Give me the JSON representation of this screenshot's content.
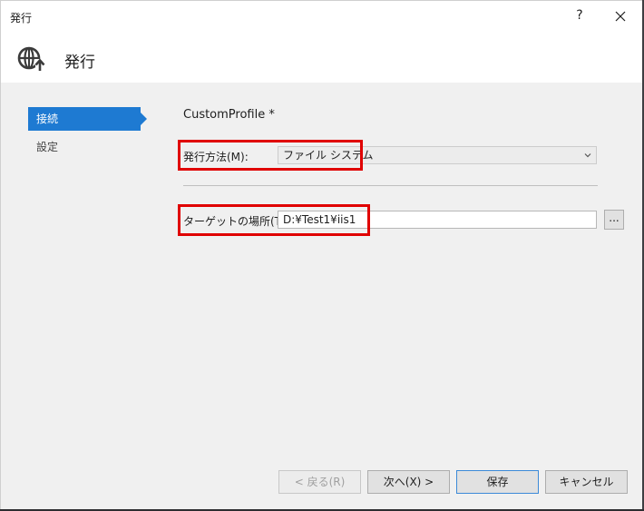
{
  "window": {
    "title": "発行",
    "help_label": "?"
  },
  "header": {
    "title": "発行"
  },
  "nav": {
    "items": [
      {
        "label": "接続",
        "active": true
      },
      {
        "label": "設定",
        "active": false
      }
    ]
  },
  "main": {
    "profile_name": "CustomProfile *",
    "publish_method_label": "発行方法(M):",
    "publish_method_value": "ファイル システム",
    "target_location_label": "ターゲットの場所(T):",
    "target_location_value": "D:¥Test1¥iis1",
    "browse_label": "..."
  },
  "buttons": {
    "back": "< 戻る(R)",
    "next": "次へ(X) >",
    "save": "保存",
    "cancel": "キャンセル"
  },
  "colors": {
    "accent": "#1e7ad2",
    "highlight": "#e00000",
    "content_bg": "#f0f0f0"
  },
  "icons": {
    "header": "globe-publish-icon",
    "close": "close-icon",
    "dropdown": "chevron-down-icon"
  }
}
